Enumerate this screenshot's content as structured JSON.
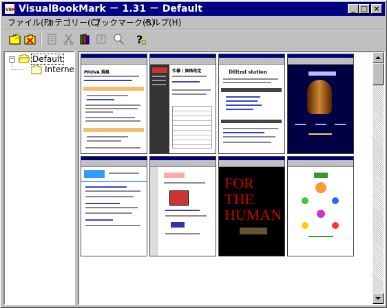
{
  "window": {
    "title": "VisualBookMark － 1.31 － Default",
    "icon_text": "VBM",
    "controls": {
      "minimize": "_",
      "maximize": "□",
      "close": "×"
    }
  },
  "menu": [
    "ファイル(F)",
    "カテゴリー(C)",
    "ブックマーク(B)",
    "ヘルプ(H)"
  ],
  "toolbar": {
    "buttons": [
      "new-folder",
      "delete-folder",
      "properties",
      "cut",
      "books",
      "help-search",
      "find",
      "help"
    ],
    "help_glyph": "?"
  },
  "tree": {
    "root": {
      "label": "Default",
      "expander": "−"
    },
    "children": [
      {
        "label": "Internet"
      }
    ]
  },
  "thumbnails": {
    "cards": [
      {
        "heading": "PROVA 規格"
      },
      {
        "heading": "仕様 / 価格改定"
      },
      {
        "heading": "DHtml station"
      },
      {
        "heading": ""
      },
      {
        "heading": ""
      },
      {
        "heading": ""
      },
      {
        "heading": "FOR THE HUMAN"
      },
      {
        "heading": ""
      }
    ],
    "human_lines": [
      "FOR",
      "THE",
      "HUMAN"
    ]
  },
  "colors": {
    "titlebar": "#000080",
    "face": "#c0c0c0",
    "human_red": "#cc0000"
  }
}
